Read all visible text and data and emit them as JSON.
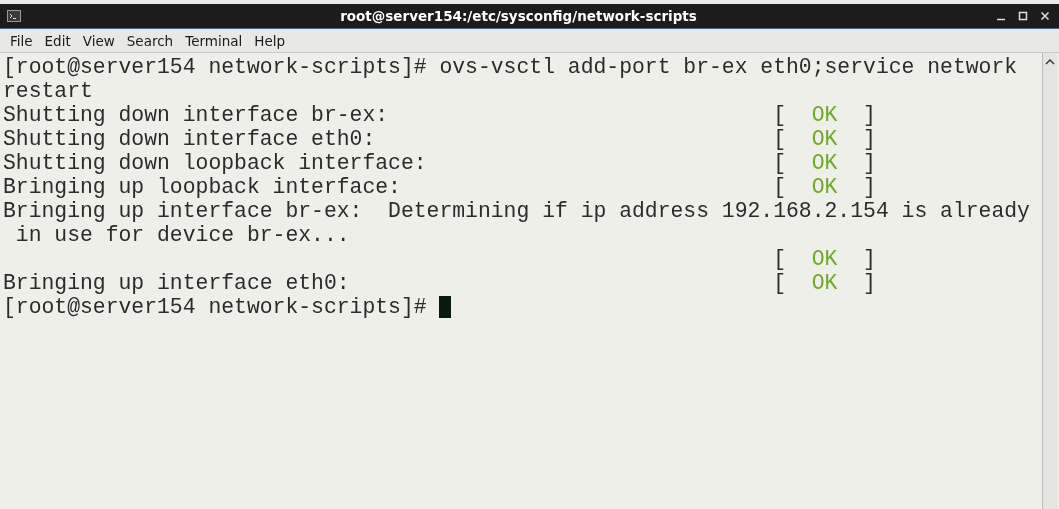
{
  "window": {
    "title": "root@server154:/etc/sysconfig/network-scripts"
  },
  "menu": [
    {
      "label": "File"
    },
    {
      "label": "Edit"
    },
    {
      "label": "View"
    },
    {
      "label": "Search"
    },
    {
      "label": "Terminal"
    },
    {
      "label": "Help"
    }
  ],
  "terminal": {
    "lines": [
      {
        "text": "[root@server154 network-scripts]# ovs-vsctl add-port br-ex eth0;service network"
      },
      {
        "text": "restart"
      },
      {
        "text": "Shutting down interface br-ex:",
        "status": {
          "open": "[",
          "label": "OK",
          "close": "]"
        }
      },
      {
        "text": "Shutting down interface eth0:",
        "status": {
          "open": "[",
          "label": "OK",
          "close": "]"
        }
      },
      {
        "text": "Shutting down loopback interface:",
        "status": {
          "open": "[",
          "label": "OK",
          "close": "]"
        }
      },
      {
        "text": "Bringing up loopback interface:",
        "status": {
          "open": "[",
          "label": "OK",
          "close": "]"
        }
      },
      {
        "text": "Bringing up interface br-ex:  Determining if ip address 192.168.2.154 is already"
      },
      {
        "text": " in use for device br-ex..."
      },
      {
        "status": {
          "open": "[",
          "label": "OK",
          "close": "]"
        }
      },
      {
        "text": "Bringing up interface eth0:",
        "status": {
          "open": "[",
          "label": "OK",
          "close": "]"
        }
      },
      {
        "text": "[root@server154 network-scripts]# ",
        "cursor": true
      }
    ]
  }
}
